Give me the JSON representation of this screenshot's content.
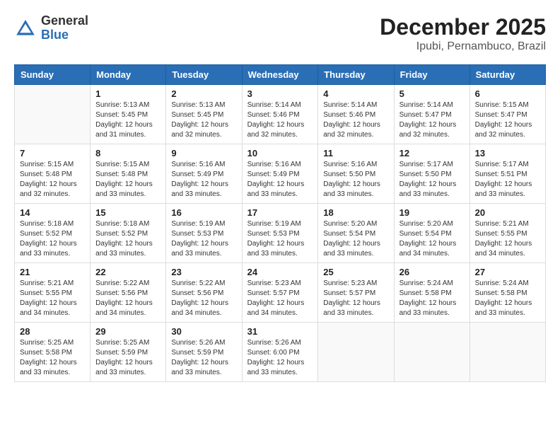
{
  "logo": {
    "general": "General",
    "blue": "Blue"
  },
  "title": {
    "month": "December 2025",
    "location": "Ipubi, Pernambuco, Brazil"
  },
  "headers": [
    "Sunday",
    "Monday",
    "Tuesday",
    "Wednesday",
    "Thursday",
    "Friday",
    "Saturday"
  ],
  "weeks": [
    [
      {
        "day": "",
        "info": ""
      },
      {
        "day": "1",
        "info": "Sunrise: 5:13 AM\nSunset: 5:45 PM\nDaylight: 12 hours\nand 31 minutes."
      },
      {
        "day": "2",
        "info": "Sunrise: 5:13 AM\nSunset: 5:45 PM\nDaylight: 12 hours\nand 32 minutes."
      },
      {
        "day": "3",
        "info": "Sunrise: 5:14 AM\nSunset: 5:46 PM\nDaylight: 12 hours\nand 32 minutes."
      },
      {
        "day": "4",
        "info": "Sunrise: 5:14 AM\nSunset: 5:46 PM\nDaylight: 12 hours\nand 32 minutes."
      },
      {
        "day": "5",
        "info": "Sunrise: 5:14 AM\nSunset: 5:47 PM\nDaylight: 12 hours\nand 32 minutes."
      },
      {
        "day": "6",
        "info": "Sunrise: 5:15 AM\nSunset: 5:47 PM\nDaylight: 12 hours\nand 32 minutes."
      }
    ],
    [
      {
        "day": "7",
        "info": "Sunrise: 5:15 AM\nSunset: 5:48 PM\nDaylight: 12 hours\nand 32 minutes."
      },
      {
        "day": "8",
        "info": "Sunrise: 5:15 AM\nSunset: 5:48 PM\nDaylight: 12 hours\nand 33 minutes."
      },
      {
        "day": "9",
        "info": "Sunrise: 5:16 AM\nSunset: 5:49 PM\nDaylight: 12 hours\nand 33 minutes."
      },
      {
        "day": "10",
        "info": "Sunrise: 5:16 AM\nSunset: 5:49 PM\nDaylight: 12 hours\nand 33 minutes."
      },
      {
        "day": "11",
        "info": "Sunrise: 5:16 AM\nSunset: 5:50 PM\nDaylight: 12 hours\nand 33 minutes."
      },
      {
        "day": "12",
        "info": "Sunrise: 5:17 AM\nSunset: 5:50 PM\nDaylight: 12 hours\nand 33 minutes."
      },
      {
        "day": "13",
        "info": "Sunrise: 5:17 AM\nSunset: 5:51 PM\nDaylight: 12 hours\nand 33 minutes."
      }
    ],
    [
      {
        "day": "14",
        "info": "Sunrise: 5:18 AM\nSunset: 5:52 PM\nDaylight: 12 hours\nand 33 minutes."
      },
      {
        "day": "15",
        "info": "Sunrise: 5:18 AM\nSunset: 5:52 PM\nDaylight: 12 hours\nand 33 minutes."
      },
      {
        "day": "16",
        "info": "Sunrise: 5:19 AM\nSunset: 5:53 PM\nDaylight: 12 hours\nand 33 minutes."
      },
      {
        "day": "17",
        "info": "Sunrise: 5:19 AM\nSunset: 5:53 PM\nDaylight: 12 hours\nand 33 minutes."
      },
      {
        "day": "18",
        "info": "Sunrise: 5:20 AM\nSunset: 5:54 PM\nDaylight: 12 hours\nand 33 minutes."
      },
      {
        "day": "19",
        "info": "Sunrise: 5:20 AM\nSunset: 5:54 PM\nDaylight: 12 hours\nand 34 minutes."
      },
      {
        "day": "20",
        "info": "Sunrise: 5:21 AM\nSunset: 5:55 PM\nDaylight: 12 hours\nand 34 minutes."
      }
    ],
    [
      {
        "day": "21",
        "info": "Sunrise: 5:21 AM\nSunset: 5:55 PM\nDaylight: 12 hours\nand 34 minutes."
      },
      {
        "day": "22",
        "info": "Sunrise: 5:22 AM\nSunset: 5:56 PM\nDaylight: 12 hours\nand 34 minutes."
      },
      {
        "day": "23",
        "info": "Sunrise: 5:22 AM\nSunset: 5:56 PM\nDaylight: 12 hours\nand 34 minutes."
      },
      {
        "day": "24",
        "info": "Sunrise: 5:23 AM\nSunset: 5:57 PM\nDaylight: 12 hours\nand 34 minutes."
      },
      {
        "day": "25",
        "info": "Sunrise: 5:23 AM\nSunset: 5:57 PM\nDaylight: 12 hours\nand 33 minutes."
      },
      {
        "day": "26",
        "info": "Sunrise: 5:24 AM\nSunset: 5:58 PM\nDaylight: 12 hours\nand 33 minutes."
      },
      {
        "day": "27",
        "info": "Sunrise: 5:24 AM\nSunset: 5:58 PM\nDaylight: 12 hours\nand 33 minutes."
      }
    ],
    [
      {
        "day": "28",
        "info": "Sunrise: 5:25 AM\nSunset: 5:58 PM\nDaylight: 12 hours\nand 33 minutes."
      },
      {
        "day": "29",
        "info": "Sunrise: 5:25 AM\nSunset: 5:59 PM\nDaylight: 12 hours\nand 33 minutes."
      },
      {
        "day": "30",
        "info": "Sunrise: 5:26 AM\nSunset: 5:59 PM\nDaylight: 12 hours\nand 33 minutes."
      },
      {
        "day": "31",
        "info": "Sunrise: 5:26 AM\nSunset: 6:00 PM\nDaylight: 12 hours\nand 33 minutes."
      },
      {
        "day": "",
        "info": ""
      },
      {
        "day": "",
        "info": ""
      },
      {
        "day": "",
        "info": ""
      }
    ]
  ]
}
